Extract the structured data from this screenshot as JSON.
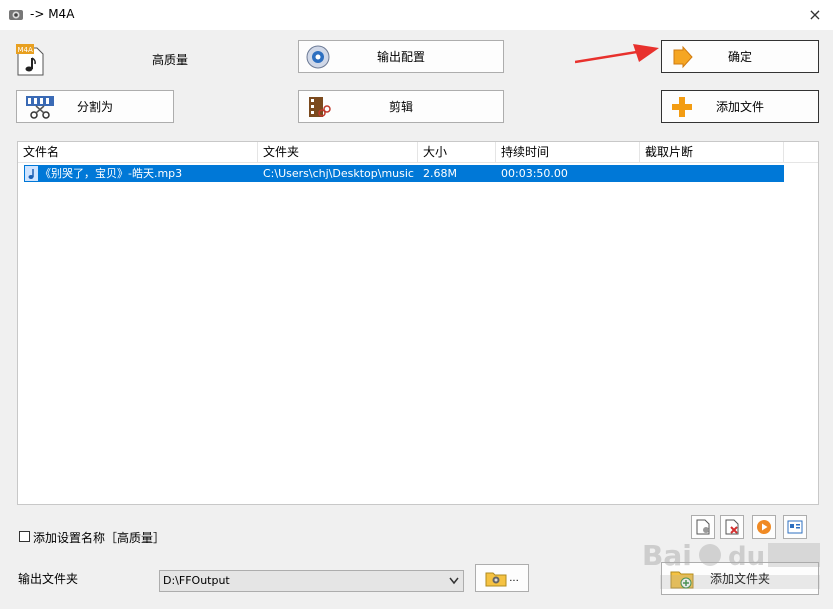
{
  "window": {
    "title": "-> M4A",
    "close": "×"
  },
  "toolbar": {
    "quality_label": "高质量",
    "output_config": "输出配置",
    "ok": "确定",
    "split": "分割为",
    "edit": "剪辑",
    "add_file": "添加文件",
    "m4a_badge": "M4A"
  },
  "list": {
    "columns": [
      "文件名",
      "文件夹",
      "大小",
      "持续时间",
      "截取片断"
    ],
    "rows": [
      {
        "name": "《别哭了，宝贝》-皓天.mp3",
        "folder": "C:\\Users\\chj\\Desktop\\music",
        "size": "2.68M",
        "duration": "00:03:50.00",
        "clip": ""
      }
    ]
  },
  "footer": {
    "add_settings_name": "添加设置名称［高质量］",
    "output_folder_label": "输出文件夹",
    "output_folder_value": "D:\\FFOutput",
    "browse_dots": "...",
    "add_folder": "添加文件夹"
  },
  "colors": {
    "selection": "#0078d7",
    "arrow": "#e8312d",
    "plus": "#f39c12"
  }
}
